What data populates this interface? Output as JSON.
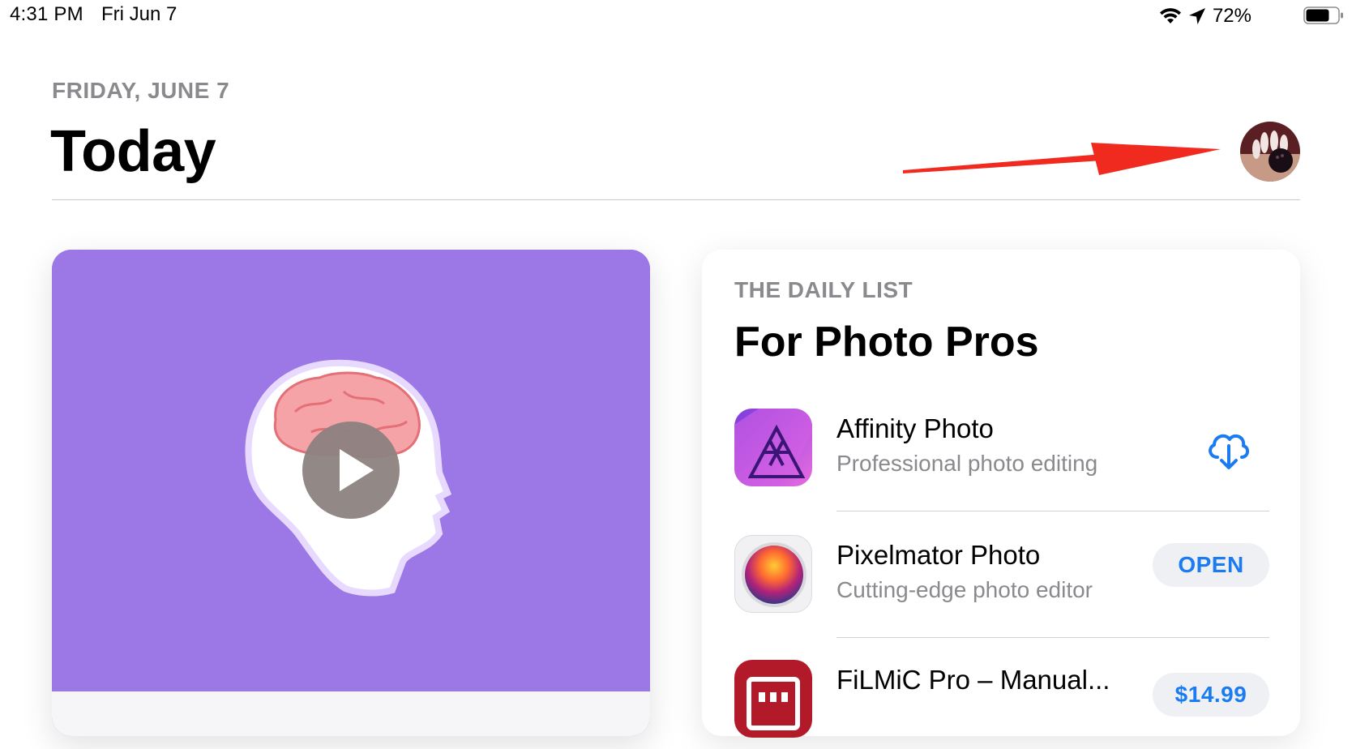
{
  "status_bar": {
    "time": "4:31 PM",
    "date": "Fri Jun 7",
    "battery": "72%",
    "icons": [
      "wifi-icon",
      "location-arrow-icon",
      "battery-icon"
    ]
  },
  "header": {
    "date_label": "FRIDAY, JUNE 7",
    "title": "Today"
  },
  "featured": {
    "art": "head-with-brain-illustration",
    "accent": "#9c77e6"
  },
  "daily_list": {
    "eyebrow": "THE DAILY LIST",
    "title": "For Photo Pros",
    "apps": [
      {
        "name": "Affinity Photo",
        "subtitle": "Professional photo editing",
        "action": "download-cloud-icon"
      },
      {
        "name": "Pixelmator Photo",
        "subtitle": "Cutting-edge photo editor",
        "action_label": "OPEN"
      },
      {
        "name": "FiLMiC Pro – Manual...",
        "subtitle": "",
        "action_label": "$14.99"
      }
    ]
  },
  "colors": {
    "accent_blue": "#1a7cf0",
    "annotation_arrow": "#f02a1e"
  }
}
